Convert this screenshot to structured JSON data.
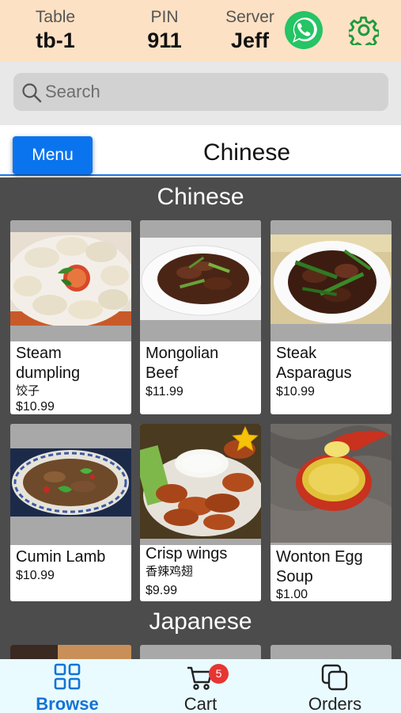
{
  "header": {
    "table_label": "Table",
    "table_value": "tb-1",
    "pin_label": "PIN",
    "pin_value": "911",
    "server_label": "Server",
    "server_value": "Jeff",
    "whatsapp_icon": "whatsapp-icon",
    "settings_icon": "gear-icon"
  },
  "search": {
    "placeholder": "Search",
    "icon": "search-icon"
  },
  "category_bar": {
    "menu_button": "Menu",
    "title": "Chinese"
  },
  "sections": [
    {
      "title": "Chinese",
      "items": [
        {
          "name_line1": "Steam",
          "name_line2": "dumpling",
          "subtitle": "饺子",
          "price": "$10.99"
        },
        {
          "name_line1": "Mongolian",
          "name_line2": "Beef",
          "subtitle": "",
          "price": "$11.99"
        },
        {
          "name_line1": "Steak",
          "name_line2": "Asparagus",
          "subtitle": "",
          "price": "$10.99"
        },
        {
          "name_line1": "Cumin Lamb",
          "name_line2": "",
          "subtitle": "",
          "price": "$10.99"
        },
        {
          "name_line1": "Crisp wings",
          "name_line2": "",
          "subtitle": "香辣鸡翅",
          "price": "$9.99",
          "starred": true
        },
        {
          "name_line1": "Wonton Egg",
          "name_line2": "Soup",
          "subtitle": "",
          "price": "$1.00"
        }
      ]
    },
    {
      "title": "Japanese",
      "items": []
    }
  ],
  "bottom_nav": {
    "browse_label": "Browse",
    "cart_label": "Cart",
    "cart_badge": "5",
    "orders_label": "Orders",
    "active_tab": "Browse"
  },
  "colors": {
    "header_bg": "#fde1c4",
    "accent_blue": "#0a74ef",
    "content_bg": "#4c4c4c",
    "whatsapp_green": "#25c464",
    "settings_green": "#1e9a3c",
    "badge_red": "#e73533",
    "nav_bg": "#e9fbff"
  }
}
